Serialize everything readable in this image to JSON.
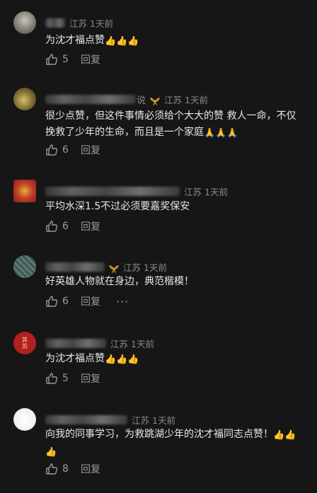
{
  "comments": [
    {
      "name_tail": "",
      "location": "江苏",
      "time": "1天前",
      "text": "为沈才福点赞",
      "emojis": [
        "👍",
        "👍",
        "👍"
      ],
      "likes": "5",
      "reply_label": "回复",
      "badge": false
    },
    {
      "name_tail": "说",
      "location": "江苏",
      "time": "1天前",
      "text": "很少点赞，但这件事情必须给个大大的赞 救人一命，不仅挽救了少年的生命，而且是一个家庭",
      "emojis": [
        "🙏",
        "🙏",
        "🙏"
      ],
      "likes": "6",
      "reply_label": "回复",
      "badge": true
    },
    {
      "name_tail": "",
      "location": "江苏",
      "time": "1天前",
      "text": "平均水深1.5不过必须要嘉奖保安",
      "emojis": [],
      "likes": "6",
      "reply_label": "回复",
      "badge": false
    },
    {
      "name_tail": "",
      "location": "江苏",
      "time": "1天前",
      "text": "好英雄人物就在身边，典范楷模！",
      "emojis": [],
      "likes": "6",
      "reply_label": "回复",
      "badge": true,
      "more": "···"
    },
    {
      "name_tail": "",
      "location": "江苏",
      "time": "1天前",
      "text": "为沈才福点赞",
      "emojis": [
        "👍",
        "👍",
        "👍"
      ],
      "likes": "5",
      "reply_label": "回复",
      "badge": false,
      "avatar_text": "其凯"
    },
    {
      "name_tail": "",
      "location": "江苏",
      "time": "1天前",
      "text": "向我的同事学习，为救跳湖少年的沈才福同志点赞！",
      "emojis": [
        "👍",
        "👍",
        "👍"
      ],
      "likes": "8",
      "reply_label": "回复",
      "badge": false
    }
  ],
  "colors": {
    "background": "#161616",
    "text": "#e8e8e8",
    "muted": "#8a8a8a",
    "badge": "#f0a32a",
    "emoji": "#f2c318"
  }
}
